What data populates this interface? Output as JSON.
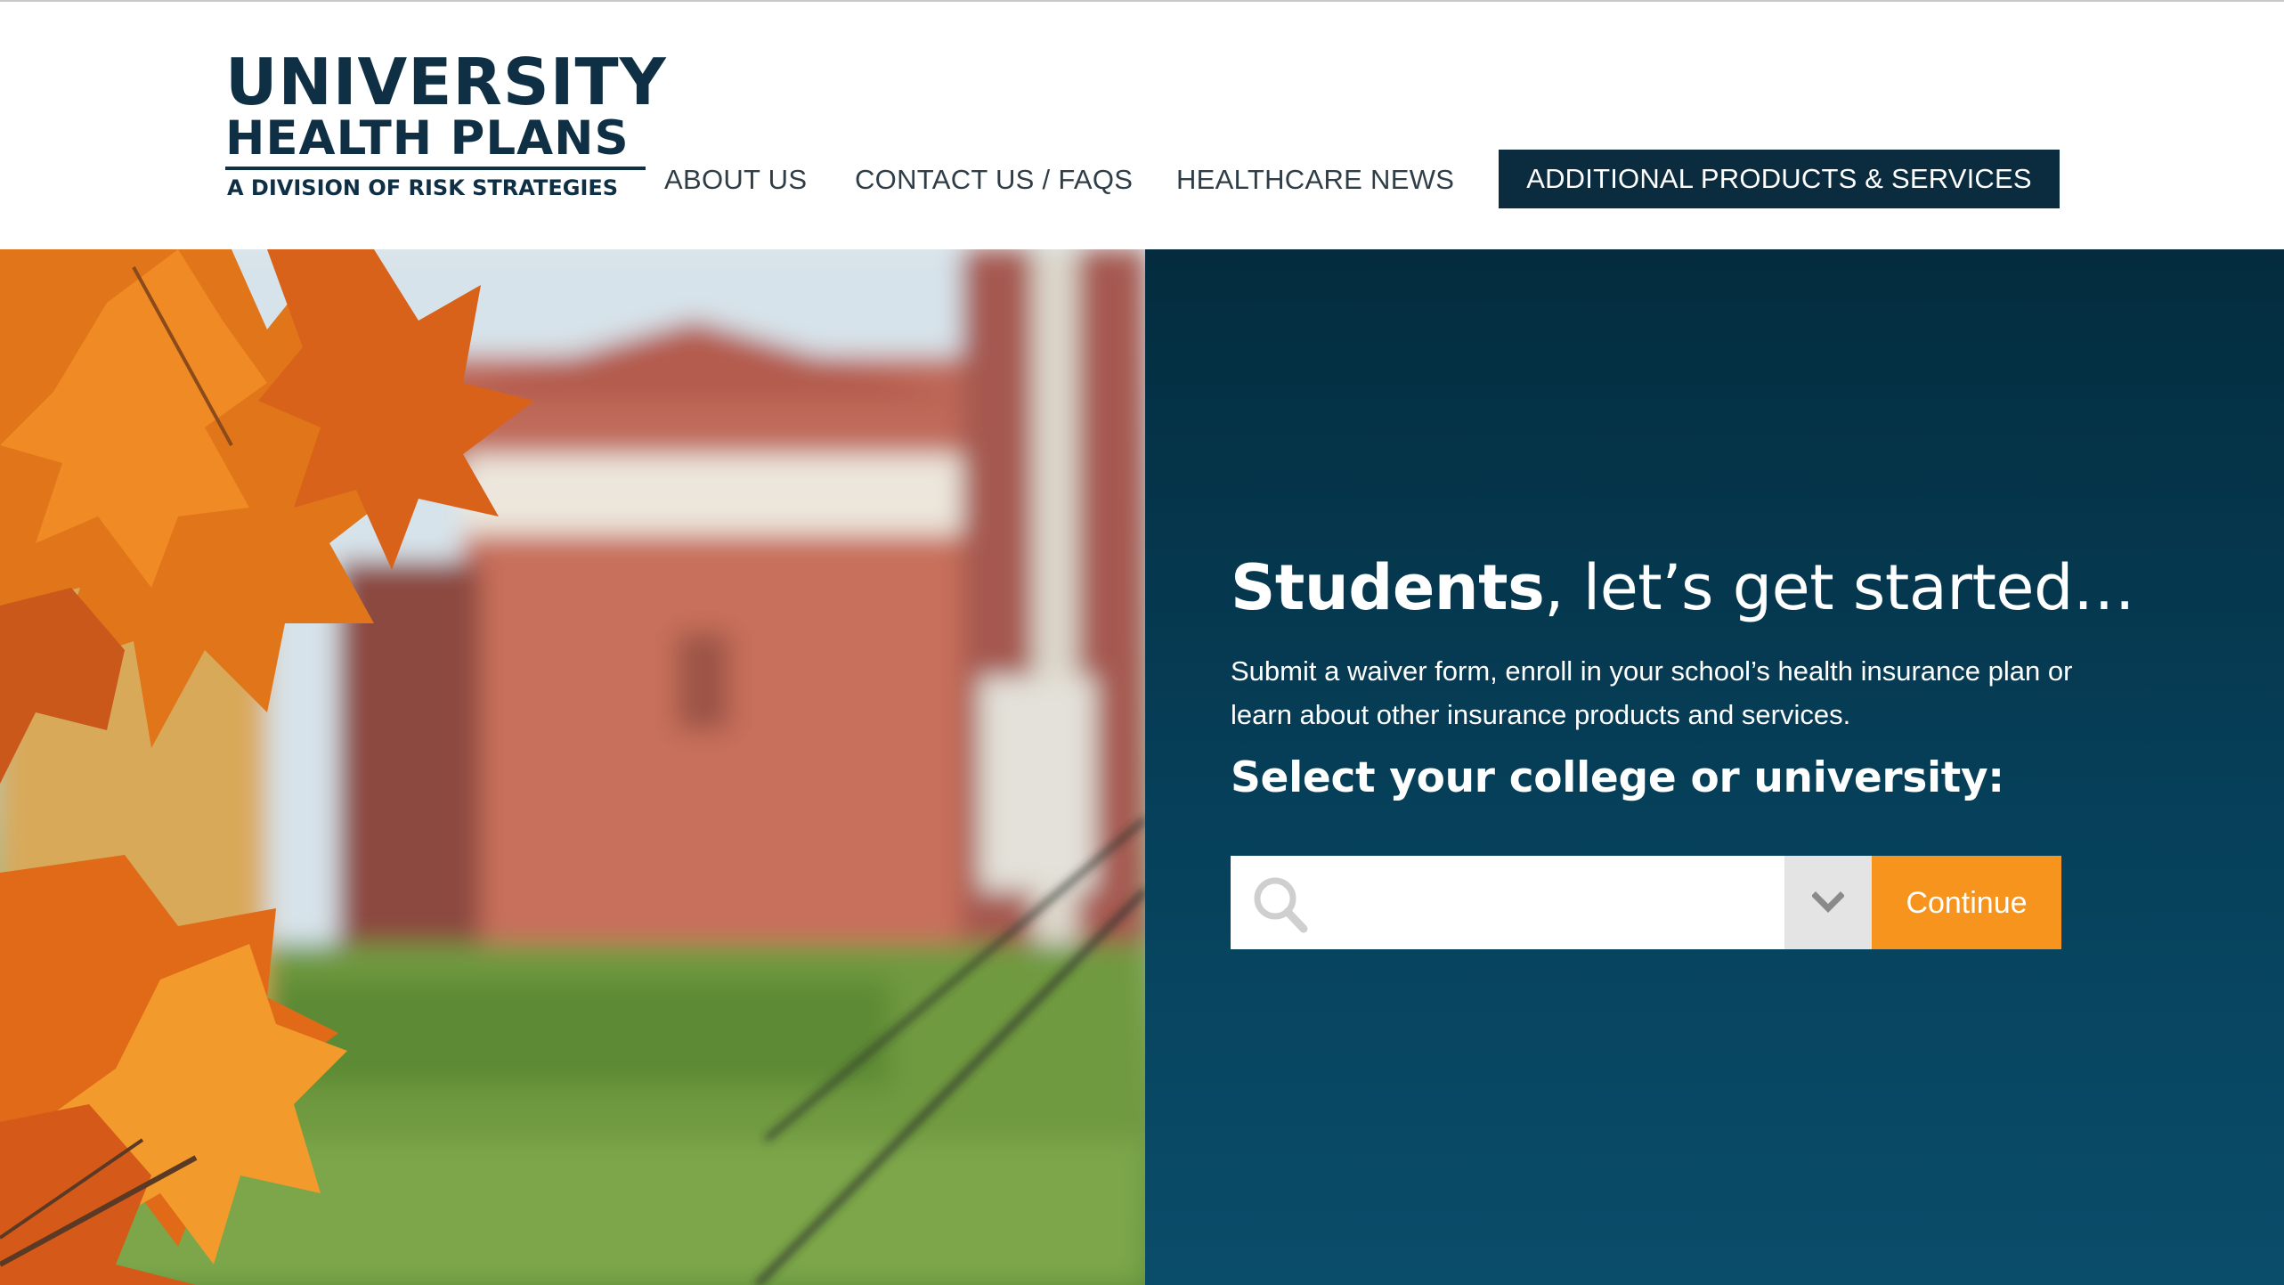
{
  "brand": {
    "name_line1": "UNIVERSITY",
    "name_line2": "HEALTH PLANS",
    "tagline": "A DIVISION OF RISK STRATEGIES"
  },
  "nav": {
    "items": [
      {
        "label": "ABOUT US"
      },
      {
        "label": "CONTACT US / FAQS"
      },
      {
        "label": "HEALTHCARE NEWS"
      }
    ],
    "cta_label": "ADDITIONAL PRODUCTS & SERVICES"
  },
  "hero": {
    "title_strong": "Students",
    "title_rest": ", let’s get started…",
    "description": "Submit a waiver form, enroll in your school’s health insurance plan or learn about other insurance products and services.",
    "select_label": "Select your college or university:",
    "search": {
      "value": "",
      "placeholder": "",
      "icon": "search-icon"
    },
    "dropdown_icon": "chevron-down-icon",
    "continue_label": "Continue"
  },
  "colors": {
    "brand_navy": "#0e2f44",
    "cta_bg": "#0b2b3e",
    "panel_top": "#042c3e",
    "panel_bottom": "#0a4d6a",
    "continue_orange": "#f7941d",
    "dropdown_bg": "#e4e4e4"
  }
}
